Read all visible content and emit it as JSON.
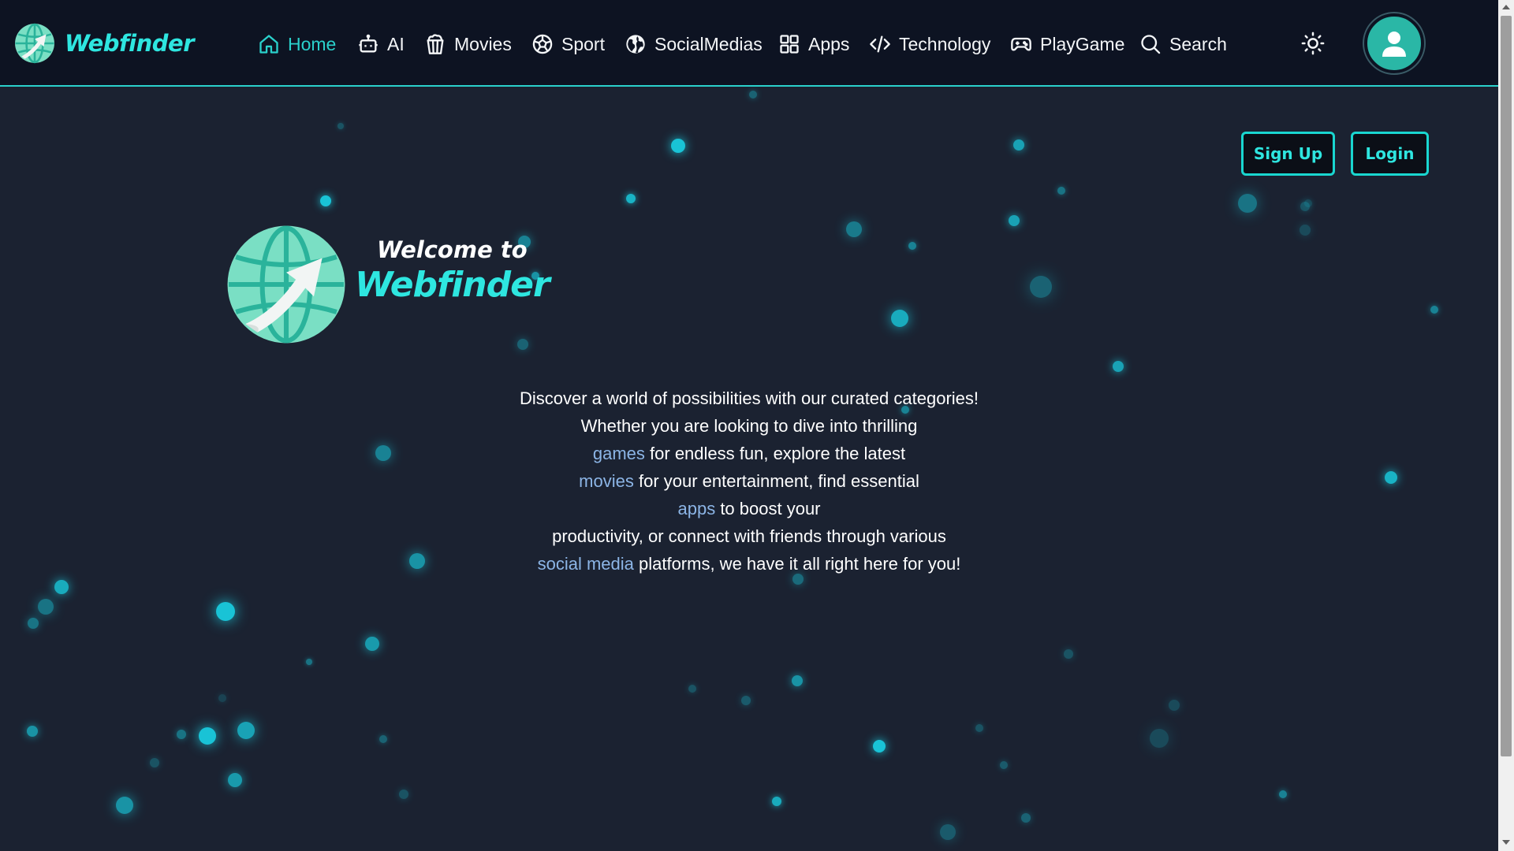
{
  "brand": {
    "name": "Webfinder"
  },
  "nav": {
    "items": [
      {
        "label": "Home",
        "icon": "home-icon",
        "active": true
      },
      {
        "label": "AI",
        "icon": "robot-icon"
      },
      {
        "label": "Movies",
        "icon": "popcorn-icon"
      },
      {
        "label": "Sport",
        "icon": "soccer-ball-icon"
      },
      {
        "label": "SocialMedias",
        "icon": "globe-icon"
      },
      {
        "label": "Apps",
        "icon": "grid-icon"
      },
      {
        "label": "Technology",
        "icon": "code-icon"
      },
      {
        "label": "PlayGame",
        "icon": "gamepad-icon"
      },
      {
        "label": "Search",
        "icon": "search-icon"
      }
    ],
    "theme_icon": "sun-icon",
    "avatar_icon": "user-icon"
  },
  "auth": {
    "signup_label": "Sign Up",
    "login_label": "Login"
  },
  "hero": {
    "welcome": "Welcome to",
    "title": "Webfinder",
    "lines": [
      {
        "text": "Discover a world of possibilities with our curated categories!"
      },
      {
        "text": "Whether you are looking to dive into thrilling"
      },
      {
        "link": "games",
        "text": " for endless fun, explore the latest"
      },
      {
        "link": "movies",
        "text": " for your entertainment, find essential"
      },
      {
        "link": "apps",
        "text": " to boost your"
      },
      {
        "text": "productivity, or connect with friends through various"
      },
      {
        "link": "social media",
        "text": " platforms, we have it all right here for you!"
      }
    ]
  },
  "colors": {
    "accent": "#2ee6e0",
    "nav_bg": "#0d1322",
    "page_bg": "#1b2231",
    "link": "#8cb5e6",
    "particle": "#19c3d6"
  }
}
